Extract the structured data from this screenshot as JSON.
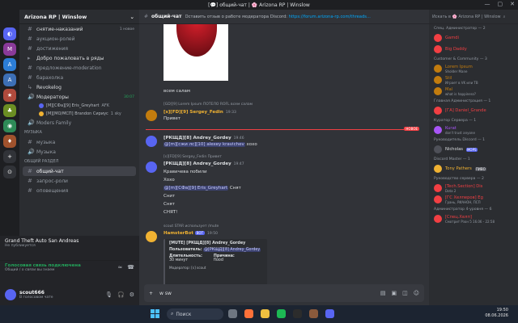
{
  "window": {
    "title": "[💬] общий-чат | 🌸 Arizona RP | Winslow"
  },
  "guild": {
    "name": "Arizona RP | Winslow"
  },
  "channels": [
    {
      "label": "снятие-наказаний",
      "badge": "1 новое"
    },
    {
      "label": "аукцион-ролей"
    },
    {
      "label": "достижения"
    },
    {
      "label": "Добро пожаловать в ряды"
    },
    {
      "label": "предложение-moderation"
    },
    {
      "label": "барахолка"
    },
    {
      "label": "Revokelog"
    },
    {
      "label": "Модераторы",
      "badge": "30:07"
    }
  ],
  "voice_users": [
    {
      "name": "[M][СФа][9] Eris_Greyhart",
      "tag": "AFK"
    },
    {
      "name": "[M][МО/МСП] Brandon Сириус",
      "tag": "1 sky"
    }
  ],
  "voice_channel_2": {
    "label": "Moders Family"
  },
  "category_music": {
    "label": "МУЗЫКА"
  },
  "music_channels": [
    {
      "label": "музыка"
    },
    {
      "label": "Музыка"
    }
  ],
  "category_general": {
    "label": "ОБЩИЙ РАЗДЕЛ"
  },
  "general_channels": [
    {
      "label": "общий-чат"
    },
    {
      "label": "запрос-роли"
    },
    {
      "label": "оповещения"
    }
  ],
  "voice_panel": {
    "title": "Grand Theft Auto San Andreas",
    "status": "Не публикуется"
  },
  "connection": {
    "title": "Голосовая связь подключена",
    "sub": "Общий / о связи вы знаем"
  },
  "user": {
    "name": "scout666",
    "status": "В голосовом чате"
  },
  "header": {
    "channel": "общий-чат",
    "topic": "Оставить отзыв о работе модератора Discord:",
    "link": "https://forum.arizona-rp.com/threads..."
  },
  "messages": {
    "m1": "всем салам",
    "m2_reply": "[GD][9] Lorem Ipsum ПОТЕЛО",
    "m2_reply_tail": "ROFL  всем салам",
    "m3_name": "[s][FD][9] Sergey_Fedin",
    "m3_time": "19:33",
    "m3_text": "Привет",
    "new_label": "НОВОЕ",
    "m4_name": "[РКЩД][8] Andrey_Gordey",
    "m4_time": "19:46",
    "m4_mention": "@[m][сжи лс][10] alexey kravichev",
    "m4_text": "хохо",
    "m5_reply": "[s][FD][9] Sergey_Fedin  Привет",
    "m5_name": "[РКЩД][8] Andrey_Gordey",
    "m5_time": "19:47",
    "m5_l1": "Кравичева побили",
    "m5_l2": "Хохо",
    "m5_mention": "@[m][СФа][9] Eris_Greyhart",
    "m5_l3": "Снят",
    "m5_l4": "Снит",
    "m5_l5": "Снят",
    "m5_l6": "СНЯТ!",
    "bot_reply": "scout  STAR использует  /mute",
    "bot_name": "HamsterBot",
    "bot_tag": "BOT",
    "bot_time": "19:50"
  },
  "embed": {
    "title": "[MUTE] [РКЩД][8] Andrey_Gordey",
    "user_label": "Пользователь:",
    "user_value": "@[РКЩД][8] Andrey_Gordey",
    "dur_label": "Длительность:",
    "dur_value": "30 минут",
    "reason_label": "Причина:",
    "reason_value": "flood",
    "footer": "Модератор: [s] scout"
  },
  "composer": {
    "value": "w sw"
  },
  "member_search": {
    "label": "Искать в 🌸 Arizona RP | Winslow"
  },
  "member_categories": [
    {
      "label": "Спец. Администратор — 2"
    },
    {
      "label": "Customer & Community — 3"
    },
    {
      "label": "Главная Администрация — 1"
    },
    {
      "label": "Куратор Сервера — 1"
    },
    {
      "label": "Руководитель Discord — 1"
    },
    {
      "label": "Discord Master — 1"
    },
    {
      "label": "Руководство сервера — 2"
    },
    {
      "label": "Администратор 4-уровня — 6"
    }
  ],
  "members": [
    {
      "name": "Gamdi",
      "color": "#f23f43"
    },
    {
      "name": "Big Daddy",
      "color": "#f23f43"
    },
    {
      "name": "Lorem Ipsum",
      "color": "#c27c0e",
      "sub": "Sholder Mane"
    },
    {
      "name": "Stil",
      "color": "#c27c0e",
      "sub": "Играет в VK или ТВ"
    },
    {
      "name": "Mal",
      "color": "#c27c0e",
      "sub": "what is happiness?"
    },
    {
      "name": "[ГА] Daniel_Grande",
      "color": "#f23f43"
    },
    {
      "name": "Kurat",
      "color": "#a855f7",
      "sub": "don't trust anyone"
    },
    {
      "name": "Nicholas",
      "color": "#dbdee1",
      "sub": "MOPS"
    },
    {
      "name": "Tony Pathers",
      "color": "#f0b232",
      "sub": "ПИВО"
    },
    {
      "name": "[Tech.Section] Dis",
      "color": "#f23f43",
      "sub": "Dota 2"
    },
    {
      "name": "[ГС Хелперов] Eg",
      "color": "#f23f43",
      "sub": "Грань, РИАНОН, ПСП"
    },
    {
      "name": "[Спец.Хелп]",
      "color": "#f23f43",
      "sub": "Смотрит Рзон 5 16.06 - 22:58"
    }
  ],
  "taskbar": {
    "search": "Поиск",
    "time": "19:50",
    "date": "08.06.2026"
  }
}
